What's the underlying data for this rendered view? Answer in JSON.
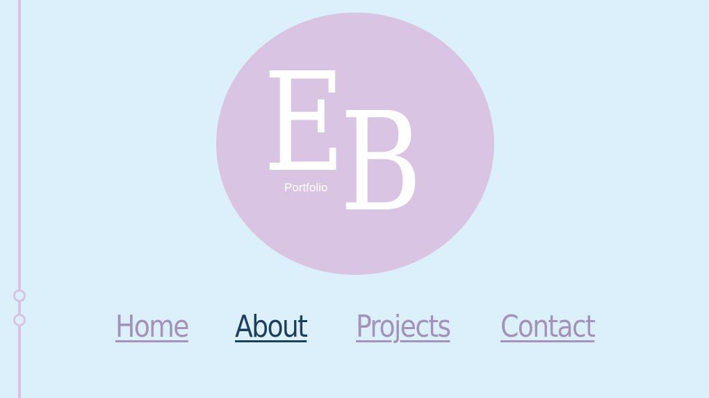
{
  "logo": {
    "letters": "EB",
    "letter_e": "E",
    "letter_b": "B",
    "subtitle": "Portfolio"
  },
  "nav": {
    "items": [
      {
        "label": "Home",
        "active": false
      },
      {
        "label": "About",
        "active": true
      },
      {
        "label": "Projects",
        "active": false
      },
      {
        "label": "Contact",
        "active": false
      }
    ]
  },
  "colors": {
    "background": "#dcf0fb",
    "accent_lilac": "#d9c4e4",
    "timeline": "#d8c3e3",
    "link": "#a592b8",
    "link_active": "#1c3f5e",
    "logo_text": "#ffffff"
  }
}
